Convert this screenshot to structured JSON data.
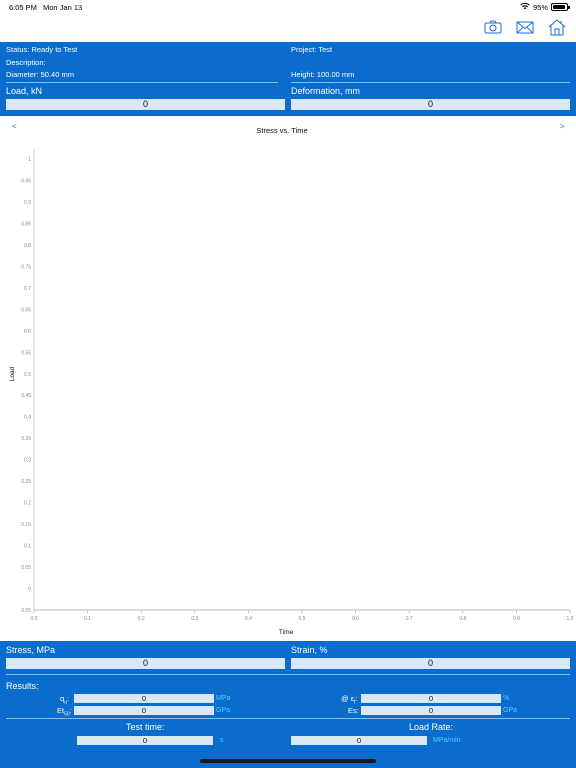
{
  "status_bar": {
    "time": "6:05 PM",
    "date": "Mon Jan 13",
    "battery": "95%",
    "battery_level": 0.95
  },
  "toolbar": {
    "icons": [
      "camera-icon",
      "mail-icon",
      "home-icon"
    ]
  },
  "info": {
    "status": "Status: Ready to Test",
    "project": "Project: Test",
    "description": "Description:",
    "diameter": "Diameter: 50.40 mm",
    "height": "Height: 100.00 mm"
  },
  "load": {
    "label": "Load, kN",
    "value": "0"
  },
  "deformation": {
    "label": "Deformation, mm",
    "value": "0"
  },
  "chart_nav": {
    "prev": "<",
    "next": ">"
  },
  "chart_data": {
    "type": "line",
    "title": "Stress vs. Time",
    "xlabel": "Time",
    "ylabel": "Load",
    "x_ticks": [
      "0.0",
      "0.1",
      "0.2",
      "0.3",
      "0.4",
      "0.5",
      "0.6",
      "0.7",
      "0.8",
      "0.9",
      "1.0"
    ],
    "y_ticks": [
      "0.05",
      "0",
      "0.05",
      "0.1",
      "0.15",
      "0.2",
      "0.25",
      "0.3",
      "0.35",
      "0.4",
      "0.45",
      "0.5",
      "0.55",
      "0.6",
      "0.65",
      "0.7",
      "0.75",
      "0.8",
      "0.85",
      "0.9",
      "0.95",
      "1"
    ],
    "xlim": [
      0,
      1
    ],
    "ylim": [
      -0.05,
      1
    ],
    "series": [],
    "grid": false
  },
  "stress": {
    "label": "Stress, MPa",
    "value": "0"
  },
  "strain": {
    "label": "Strain, %",
    "value": "0"
  },
  "results": {
    "heading": "Results:",
    "qu": {
      "label": "q",
      "sub": "u",
      "colon": ":",
      "value": "0",
      "unit": "MPa"
    },
    "eps": {
      "label": "@ ε",
      "sub": "f",
      "colon": ":",
      "value": "0",
      "unit": "%"
    },
    "et50": {
      "label": "Et",
      "sub": "50",
      "colon": ":",
      "value": "0",
      "unit": "GPa"
    },
    "es": {
      "label": "Es:",
      "value": "0",
      "unit": "GPa"
    }
  },
  "test_time": {
    "label": "Test time:",
    "value": "0",
    "unit": "s"
  },
  "load_rate": {
    "label": "Load Rate:",
    "value": "0",
    "unit": "MPa/min"
  }
}
